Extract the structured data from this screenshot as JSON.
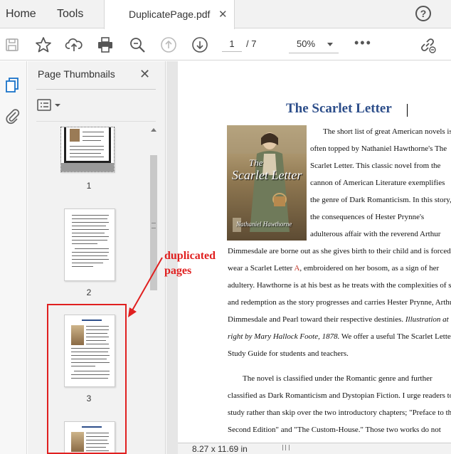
{
  "tabs": {
    "home": "Home",
    "tools": "Tools",
    "document_name": "DuplicatePage.pdf",
    "close": "✕",
    "help": "?"
  },
  "toolbar": {
    "current_page": "1",
    "total_pages": "/ 7",
    "zoom": "50%",
    "more": "•••"
  },
  "thumbnails_panel": {
    "title": "Page Thumbnails",
    "close": "✕",
    "pages": [
      {
        "number": "1"
      },
      {
        "number": "2"
      },
      {
        "number": "3"
      }
    ]
  },
  "document": {
    "title": "The Scarlet Letter",
    "cover": {
      "title_line1": "The",
      "title_line2": "Scarlet Letter",
      "author": "Nathaniel Hawthorne"
    },
    "paragraph1": {
      "l1": "The short list of great American novels is",
      "l2": "often topped by Nathaniel Hawthorne's The",
      "l3": "Scarlet Letter. This classic novel from the",
      "l4": "cannon of American Literature exemplifies",
      "l5": "the genre of Dark Romanticism. In this story,",
      "l6": "the consequences of Hester Prynne's",
      "l7": "adulterous affair with the reverend Arthur",
      "l8": "Dimmesdale are borne out as she gives birth to their child and is forced to",
      "l9a": "wear a Scarlet Letter ",
      "l9b": "A",
      "l9c": ", embroidered on her bosom, as a sign of her",
      "l10": "adultery. Hawthorne is at his best as he treats with the complexities of sin",
      "l11": "and redemption as the story progresses and carries Hester Prynne, Arthur",
      "l12": "Dimmesdale and Pearl toward their respective destinies. ",
      "l12i": "Illustration at",
      "l13i": "right by Mary Hallock Foote, 1878.",
      "l13": " We offer a useful The Scarlet Letter",
      "l14": "Study Guide for students and teachers."
    },
    "paragraph2": {
      "l1": "The novel is classified under the Romantic genre and further",
      "l2": "classified as Dark Romanticism and Dystopian Fiction. I urge readers to",
      "l3": "study rather than skip over the two introductory chapters; \"Preface to the",
      "l4": "Second Edition\" and \"The Custom-House.\" Those two works do not"
    }
  },
  "page_size": "8.27 x 11.69 in",
  "annotation": {
    "line1": "duplicated",
    "line2": "pages",
    "color": "#e02020"
  }
}
